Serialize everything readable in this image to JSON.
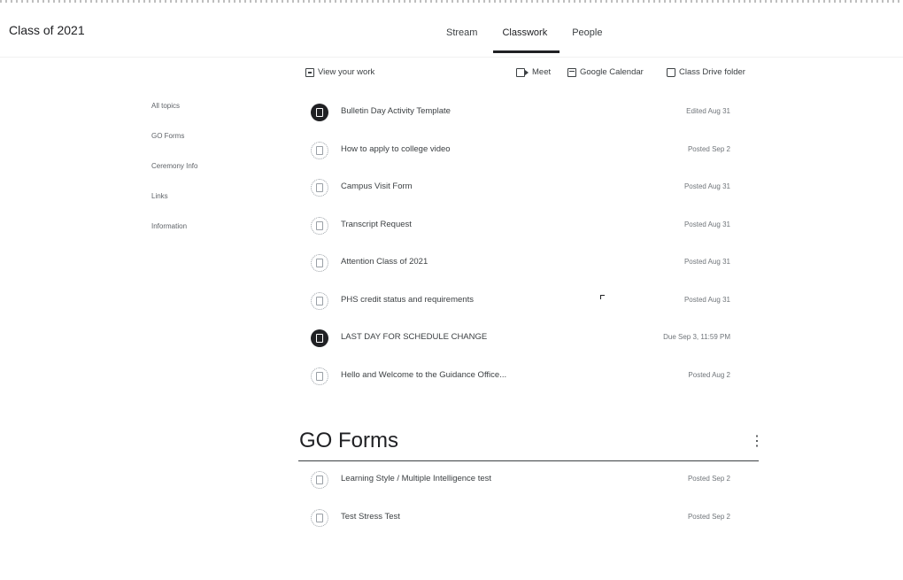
{
  "app": {
    "title": "Class of 2021"
  },
  "tabs": [
    {
      "label": "Stream"
    },
    {
      "label": "Classwork"
    },
    {
      "label": "People"
    }
  ],
  "toolbar": {
    "view_work": "View your work",
    "meet": "Meet",
    "calendar": "Google Calendar",
    "drive": "Class Drive folder"
  },
  "sidebar": {
    "items": [
      "All topics",
      "GO Forms",
      "Ceremony Info",
      "Links",
      "Information"
    ]
  },
  "stream_items": [
    {
      "title": "Bulletin Day Activity Template",
      "date": "Edited Aug 31",
      "icon": "assignment-icon",
      "dark": true
    },
    {
      "title": "How to apply to college video",
      "date": "Posted Sep 2",
      "icon": "material-icon",
      "dark": false
    },
    {
      "title": "Campus Visit Form",
      "date": "Posted Aug 31",
      "icon": "material-icon",
      "dark": false
    },
    {
      "title": "Transcript Request",
      "date": "Posted Aug 31",
      "icon": "material-icon",
      "dark": false
    },
    {
      "title": "Attention Class of 2021",
      "date": "Posted Aug 31",
      "icon": "material-icon",
      "dark": false
    },
    {
      "title": "PHS credit status and requirements",
      "date": "Posted Aug 31",
      "icon": "material-icon",
      "dark": false
    },
    {
      "title": "LAST DAY FOR SCHEDULE CHANGE",
      "date": "Due Sep 3, 11:59 PM",
      "icon": "assignment-icon",
      "dark": true
    },
    {
      "title": "Hello and Welcome to the Guidance Office...",
      "date": "Posted Aug 2",
      "icon": "material-icon",
      "dark": false
    }
  ],
  "topic": {
    "title": "GO Forms",
    "more": "⋮",
    "items": [
      {
        "title": "Learning Style / Multiple Intelligence test",
        "date": "Posted Sep 2",
        "icon": "material-icon",
        "dark": false
      },
      {
        "title": "Test Stress Test",
        "date": "Posted Sep 2",
        "icon": "material-icon",
        "dark": false
      }
    ]
  }
}
